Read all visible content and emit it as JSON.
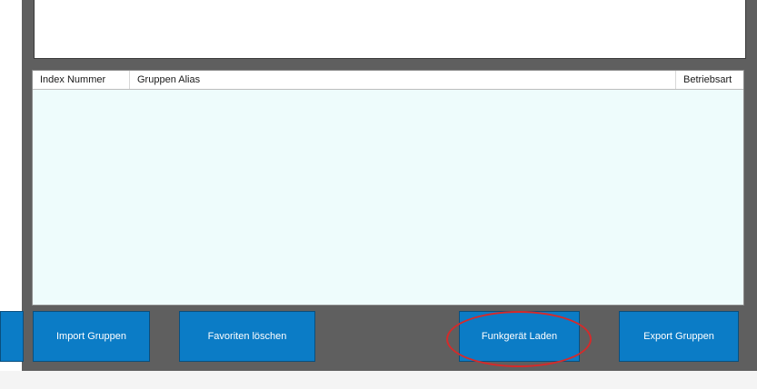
{
  "list": {
    "columns": [
      {
        "label": "Index Nummer"
      },
      {
        "label": "Gruppen Alias"
      },
      {
        "label": "Betriebsart"
      }
    ],
    "rows": []
  },
  "buttons": {
    "import": "Import Gruppen",
    "favoriten": "Favoriten löschen",
    "laden": "Funkgerät Laden",
    "export": "Export Gruppen"
  },
  "colors": {
    "frame": "#5f5f5f",
    "list_background": "#eefcfc",
    "button": "#0b7cc6",
    "annotation": "#d62a2a"
  }
}
